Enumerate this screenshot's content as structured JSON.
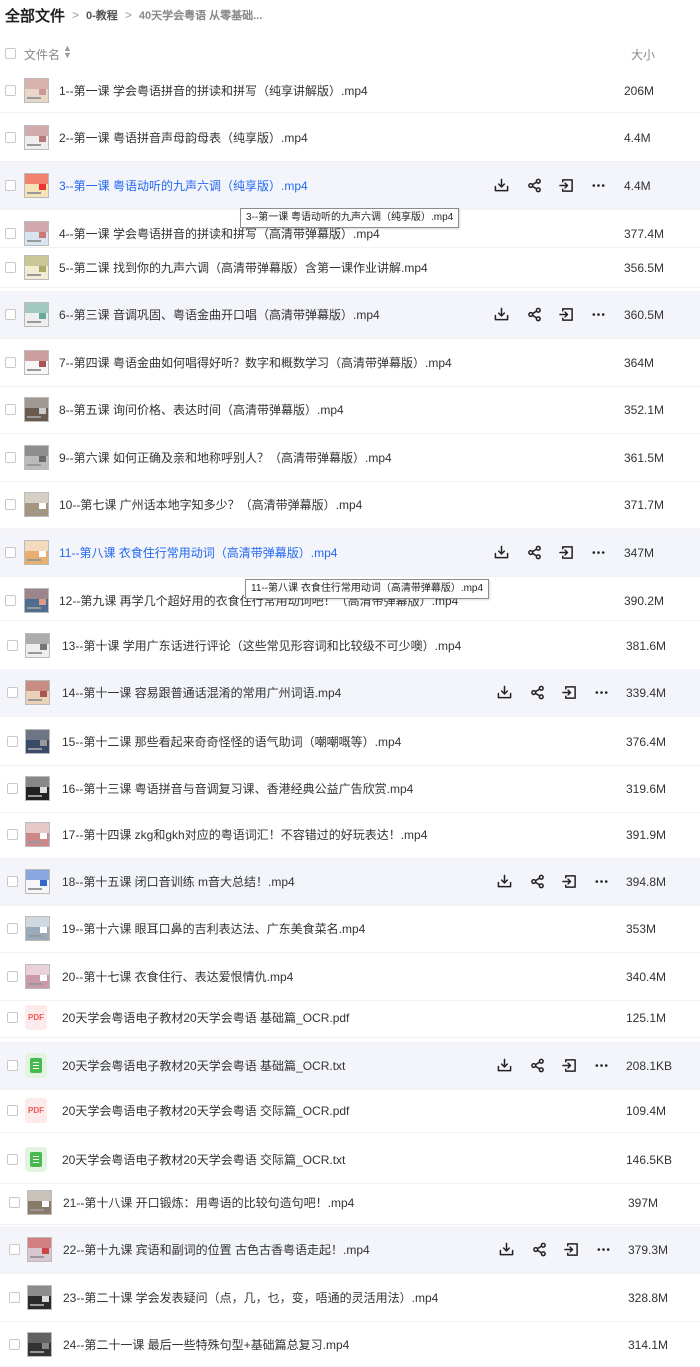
{
  "breadcrumb": {
    "root": "全部文件",
    "separators": [
      ">",
      ">"
    ],
    "items": [
      "0-教程",
      "40天学会粤语 从零基础..."
    ]
  },
  "header": {
    "name_col": "文件名",
    "size_col": "大小",
    "sort_icon": "sort-icon"
  },
  "icons": {
    "download": "download-icon",
    "share": "share-icon",
    "move": "move-icon",
    "more": "more-icon"
  },
  "colors": {
    "accent": "#2468f2",
    "hover_row": "#f3f5fb",
    "pdf": "#f05a5a",
    "txt": "#46b94f"
  },
  "files": [
    {
      "name": "1--第一课 学会粤语拼音的拼读和拼写（纯享讲解版）.mp4",
      "size": "206M",
      "type": "video"
    },
    {
      "name": "2--第一课 粤语拼音声母韵母表（纯享版）.mp4",
      "size": "4.4M",
      "type": "video"
    },
    {
      "name": "3--第一课 粤语动听的九声六调（纯享版）.mp4",
      "size": "4.4M",
      "type": "video",
      "hover": true,
      "blue": true
    },
    {
      "name": "4--第一课 学会粤语拼音的拼读和拼写（高清带弹幕版）.mp4",
      "size": "377.4M",
      "type": "video"
    },
    {
      "name": "5--第二课 找到你的九声六调（高清带弹幕版）含第一课作业讲解.mp4",
      "size": "356.5M",
      "type": "video"
    },
    {
      "name": "6--第三课 音调巩固、粤语金曲开口唱（高清带弹幕版）.mp4",
      "size": "360.5M",
      "type": "video",
      "hover": true
    },
    {
      "name": "7--第四课 粤语金曲如何唱得好听？数字和概数学习（高清带弹幕版）.mp4",
      "size": "364M",
      "type": "video"
    },
    {
      "name": "8--第五课 询问价格、表达时间（高清带弹幕版）.mp4",
      "size": "352.1M",
      "type": "video"
    },
    {
      "name": "9--第六课 如何正确及亲和地称呼别人？（高清带弹幕版）.mp4",
      "size": "361.5M",
      "type": "video"
    },
    {
      "name": "10--第七课 广州话本地字知多少？（高清带弹幕版）.mp4",
      "size": "371.7M",
      "type": "video"
    },
    {
      "name": "11--第八课 衣食住行常用动词（高清带弹幕版）.mp4",
      "size": "347M",
      "type": "video",
      "hover": true,
      "blue": true
    },
    {
      "name": "12--第九课 再学几个超好用的衣食住行常用动词吧！（高清带弹幕版）.mp4",
      "size": "390.2M",
      "type": "video"
    },
    {
      "name": "13--第十课 学用广东话进行评论（这些常见形容词和比较级不可少噢）.mp4",
      "size": "381.6M",
      "type": "video"
    },
    {
      "name": "14--第十一课 容易跟普通话混淆的常用广州词语.mp4",
      "size": "339.4M",
      "type": "video",
      "hover": true
    },
    {
      "name": "15--第十二课 那些看起来奇奇怪怪的语气助词（嘲嘲嘅等）.mp4",
      "size": "376.4M",
      "type": "video"
    },
    {
      "name": "16--第十三课 粤语拼音与音调复习课、香港经典公益广告欣赏.mp4",
      "size": "319.6M",
      "type": "video"
    },
    {
      "name": "17--第十四课 zkg和gkh对应的粤语词汇！不容错过的好玩表达！.mp4",
      "size": "391.9M",
      "type": "video"
    },
    {
      "name": "18--第十五课 闭口音训练 m音大总结！.mp4",
      "size": "394.8M",
      "type": "video",
      "hover": true
    },
    {
      "name": "19--第十六课 眼耳口鼻的吉利表达法、广东美食菜名.mp4",
      "size": "353M",
      "type": "video"
    },
    {
      "name": "20--第十七课 衣食住行、表达爱恨情仇.mp4",
      "size": "340.4M",
      "type": "video"
    },
    {
      "name": "20天学会粤语电子教材20天学会粤语 基础篇_OCR.pdf",
      "size": "125.1M",
      "type": "pdf",
      "icon_text": "PDF"
    },
    {
      "name": "20天学会粤语电子教材20天学会粤语 基础篇_OCR.txt",
      "size": "208.1KB",
      "type": "txt",
      "hover": true
    },
    {
      "name": "20天学会粤语电子教材20天学会粤语 交际篇_OCR.pdf",
      "size": "109.4M",
      "type": "pdf",
      "icon_text": "PDF"
    },
    {
      "name": "20天学会粤语电子教材20天学会粤语 交际篇_OCR.txt",
      "size": "146.5KB",
      "type": "txt"
    },
    {
      "name": "21--第十八课 开口锻炼：用粤语的比较句造句吧！.mp4",
      "size": "397M",
      "type": "video"
    },
    {
      "name": "22--第十九课 宾语和副词的位置 古色古香粤语走起！.mp4",
      "size": "379.3M",
      "type": "video",
      "hover": true
    },
    {
      "name": "23--第二十课 学会发表疑问（点，几，乜，变，唔通的灵活用法）.mp4",
      "size": "328.8M",
      "type": "video"
    },
    {
      "name": "24--第二十一课 最后一些特殊句型+基础篇总复习.mp4",
      "size": "314.1M",
      "type": "video"
    }
  ],
  "tooltips": [
    "3--第一课 粤语动听的九声六调（纯享版）.mp4",
    "11--第八课 衣食住行常用动词（高清带弹幕版）.mp4"
  ]
}
